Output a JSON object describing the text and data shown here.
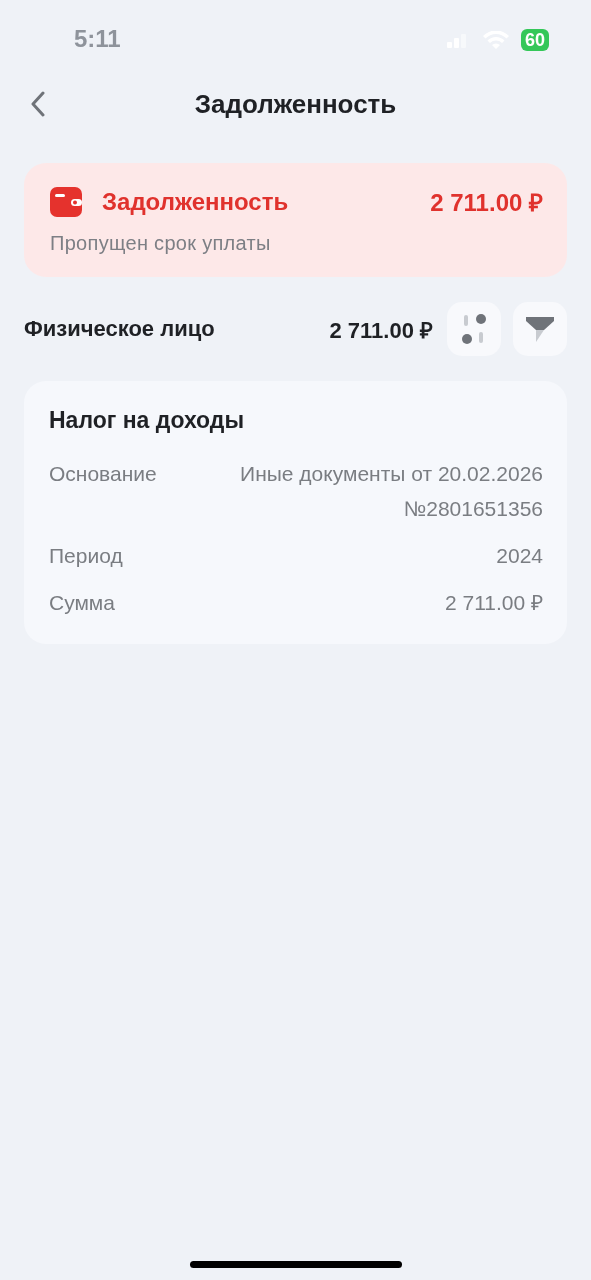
{
  "status_bar": {
    "time": "5:11",
    "battery": "60"
  },
  "header": {
    "title": "Задолженность"
  },
  "debt_summary": {
    "title": "Задолженность",
    "amount": "2 711.00 ₽",
    "note": "Пропущен срок уплаты"
  },
  "payer": {
    "label": "Физическое лицо",
    "amount": "2 711.00 ₽"
  },
  "tax_card": {
    "title": "Налог на доходы",
    "rows": [
      {
        "label": "Основание",
        "value": "Иные документы от 20.02.2026 №2801651356"
      },
      {
        "label": "Период",
        "value": "2024"
      },
      {
        "label": "Сумма",
        "value": "2 711.00 ₽"
      }
    ]
  }
}
